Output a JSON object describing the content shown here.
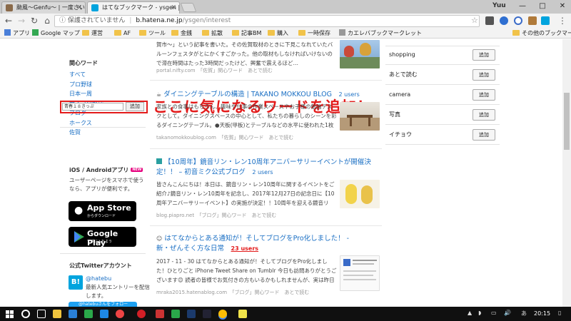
{
  "browser": {
    "tabs": [
      {
        "label": "颱風〜Genfu〜 | 一度さい"
      },
      {
        "label": "はてなブックマーク - ysgen | 関"
      }
    ],
    "user_label": "Yuu",
    "window_controls": {
      "minimize": "—",
      "maximize": "□",
      "close": "✕"
    },
    "url": {
      "warning": "保護されていません",
      "host": "b.hatena.ne.jp",
      "path": "/ysgen/interest"
    },
    "bookmarks": [
      {
        "label": "アプリ"
      },
      {
        "label": "Google マップ"
      },
      {
        "label": "運営"
      },
      {
        "label": "AF"
      },
      {
        "label": "ツール"
      },
      {
        "label": "金銭"
      },
      {
        "label": "拡散"
      },
      {
        "label": "記事BM"
      },
      {
        "label": "購入"
      },
      {
        "label": "一時保存"
      },
      {
        "label": "カエレバブックマークレット"
      },
      {
        "label": "その他のブックマーク"
      }
    ]
  },
  "sidebar": {
    "heading": "関心ワード",
    "words": [
      "すべて",
      "プロ野球",
      "日本一周",
      "女子プロ野球",
      "ブログ",
      "ホークス",
      "佐賀"
    ],
    "input_value": "青春１８きっぷ",
    "add_label": "追加",
    "app_heading": "iOS / Androidアプリ",
    "app_badge": "NEW",
    "app_desc": "ユーザーページをスマホで使うなら、アプリが便利です。",
    "appstore": {
      "big": "App Store",
      "small": "からダウンロード"
    },
    "googleplay": {
      "big": "Google Play",
      "small": "で手に入れよう"
    },
    "twitter_heading": "公式Twitterアカウント",
    "twitter_handle": "@hatebu",
    "twitter_desc": "最新人気エントリーを配信します。",
    "twitter_follow": "@hatebuさんをフォロー"
  },
  "annotation": "ここに気になるワードを追加！",
  "entries": [
    {
      "title": "",
      "users": "",
      "body": "賀市〜」という記事を書いた。その佐賀取材のときに下見こなれていたバルーンフェスタがとにかくすごかった。他の取材もしなければいけないので滞在時間はたった3時間だったけど、興奮で震えるほど…",
      "source": "portal.nifty.com",
      "tags": "「佐賀」関心ワード",
      "later": "あとで読む"
    },
    {
      "title": "ダイニングテーブルの構造 | TAKANO MOKKOU BLOG",
      "users": "2 users",
      "body": "家族との食事はもちろん、趣味や仕事の作業スペースやお子様の勉強デスクとして。ダイニングスペースの中心として、私たちの暮らしのシーンを彩るダイニングテーブル。●天板(甲板)とテーブルなどの水平に使われた1枚の板のことを指します。甲板(こういた)と名付けれ…",
      "source": "takanomokkoublog.com",
      "tags": "「佐賀」関心ワード",
      "later": "あとで読む"
    },
    {
      "title": "【10周年】鏡音リン・レン10周年アニバーサリーイベントが開催決定！！ – 初音ミク公式ブログ",
      "users": "2 users",
      "body": "皆さんこんにちは！本日は、鏡音リン・レン10周年に関するイベントをご紹介♪鏡音リン・レン10周年を記念し、2017年12月27日の記念日に【10周年アニバーサリーイベント】の実施が決定！！10周年を迎える鏡音リン・レンの最新情報をはじめ、10年間の…",
      "source": "blog.piapro.net",
      "tags": "「ブログ」関心ワード",
      "later": "あとで読む"
    },
    {
      "title": "はてなからとある通知が！そしてブログをPro化しました！ - 新・ぜんそく方な日常",
      "users": "23 users",
      "body": "2017 - 11 - 30 はてなからとある通知が！そしてブログをPro化しました！ひとりごと iPhone Tweet Share on Tumblr 今日も訪問ありがとうございます😊 読者の皆様でお気付きの方もいるかもしれませんが、実は昨日から…ブログをP…",
      "source": "mraka2015.hatenablog.com",
      "tags": "「ブログ」関心ワード",
      "later": "あとで読む"
    }
  ],
  "right_tags": [
    {
      "label": "shopping",
      "add": "追加"
    },
    {
      "label": "あとで読む",
      "add": "追加"
    },
    {
      "label": "camera",
      "add": "追加"
    },
    {
      "label": "写真",
      "add": "追加"
    },
    {
      "label": "イチョウ",
      "add": "追加"
    }
  ],
  "taskbar": {
    "clock": "20:15",
    "ime": "あ"
  },
  "colors": {
    "link": "#1a6fc4",
    "annotation_red": "#e31b1b",
    "hatena_blue": "#00a4de"
  }
}
